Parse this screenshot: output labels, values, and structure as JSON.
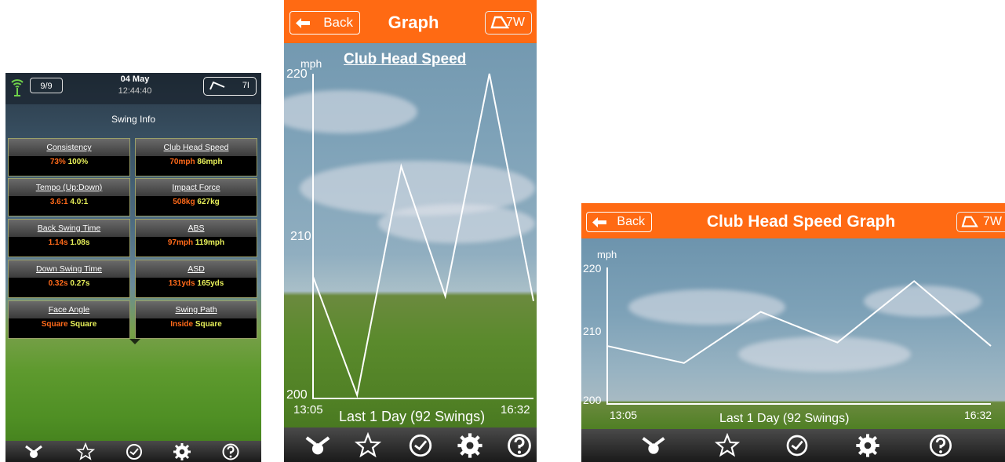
{
  "swing_info": {
    "status": {
      "swing_count": "9/9",
      "date": "04 May",
      "time": "12:44:40",
      "club": "7I"
    },
    "title": "Swing Info",
    "tiles": [
      {
        "label": "Consistency",
        "value1": "73%",
        "value2": "100%"
      },
      {
        "label": "Club Head Speed",
        "value1": "70mph",
        "value2": "86mph"
      },
      {
        "label": "Tempo (Up:Down)",
        "value1": "3.6:1",
        "value2": "4.0:1"
      },
      {
        "label": "Impact Force",
        "value1": "508kg",
        "value2": "627kg"
      },
      {
        "label": "Back Swing Time",
        "value1": "1.14s",
        "value2": "1.08s"
      },
      {
        "label": "ABS",
        "value1": "97mph",
        "value2": "119mph"
      },
      {
        "label": "Down Swing Time",
        "value1": "0.32s",
        "value2": "0.27s"
      },
      {
        "label": "ASD",
        "value1": "131yds",
        "value2": "165yds"
      },
      {
        "label": "Face Angle",
        "value1": "Square",
        "value2": "Square"
      },
      {
        "label": "Swing Path",
        "value1": "Inside",
        "value2": "Square"
      }
    ]
  },
  "graph_portrait": {
    "back_label": "Back",
    "title": "Graph",
    "club": "7W",
    "unit": "mph",
    "chart_title": "Club Head Speed",
    "y_ticks": [
      "220",
      "210",
      "200"
    ],
    "x_start": "13:05",
    "x_end": "16:32",
    "footer": "Last 1 Day (92 Swings)"
  },
  "graph_landscape": {
    "back_label": "Back",
    "title": "Club Head Speed Graph",
    "club": "7W",
    "unit": "mph",
    "y_ticks": [
      "220",
      "210",
      "200"
    ],
    "x_start": "13:05",
    "x_end": "16:32",
    "footer": "Last 1 Day (92 Swings)"
  },
  "chart_data": [
    {
      "type": "line",
      "title": "Club Head Speed",
      "ylabel": "mph",
      "ylim": [
        200,
        220
      ],
      "x_range": [
        "13:05",
        "16:32"
      ],
      "values": [
        207.5,
        200.2,
        214.3,
        206.3,
        220.0,
        206.0
      ]
    },
    {
      "type": "line",
      "ylabel": "mph",
      "ylim": [
        200,
        220
      ],
      "x_range": [
        "13:05",
        "16:32"
      ],
      "values": [
        208.5,
        206.0,
        213.5,
        209.0,
        218.0,
        208.5
      ]
    }
  ],
  "tabs": [
    "swing-tab",
    "favorites-tab",
    "history-tab",
    "settings-tab",
    "help-tab"
  ],
  "colors": {
    "header": "#ff6a13",
    "value_primary": "#ff6a1a",
    "value_secondary": "#e8f05a"
  }
}
